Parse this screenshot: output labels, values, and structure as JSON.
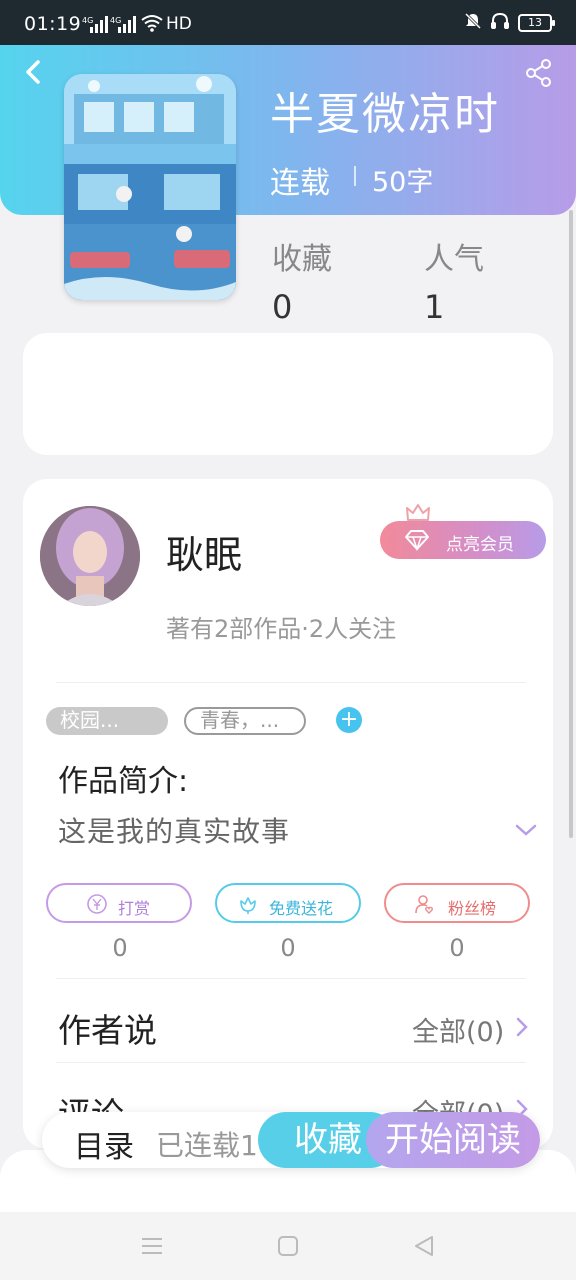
{
  "status_bar": {
    "time": "01:19",
    "signal1": "4G",
    "signal2": "4G",
    "hd": "HD",
    "battery": "13",
    "icons": [
      "mute-icon",
      "headphones-icon",
      "battery-icon",
      "wifi-icon"
    ]
  },
  "book": {
    "title": "半夏微凉时",
    "status": "连载",
    "word_count": "50字",
    "stats": [
      {
        "label": "收藏",
        "value": "0"
      },
      {
        "label": "人气",
        "value": "1"
      }
    ]
  },
  "author": {
    "name": "耿眠",
    "vip_label": "点亮会员",
    "meta": "著有2部作品·2人关注"
  },
  "tags": [
    "校园...",
    "青春，..."
  ],
  "intro": {
    "title": "作品简介:",
    "text": "这是我的真实故事"
  },
  "actions": [
    {
      "label": "打赏",
      "count": "0",
      "icon": "yen-coin-icon"
    },
    {
      "label": "免费送花",
      "count": "0",
      "icon": "flower-icon"
    },
    {
      "label": "粉丝榜",
      "count": "0",
      "icon": "user-heart-icon"
    }
  ],
  "sections": {
    "author_says": {
      "title": "作者说",
      "all": "全部(0)"
    },
    "comments": {
      "title": "评论",
      "all": "全部(0)"
    }
  },
  "bottom_bar": {
    "catalog": "目录",
    "serial": "已连载1",
    "favorite": "收藏",
    "read": "开始阅读"
  },
  "colors": {
    "header_start": "#55d4ee",
    "header_end": "#b79ce8",
    "accent_blue": "#57cfe9",
    "accent_purple": "#c49ae6",
    "vip_pink": "#f28a9a"
  }
}
